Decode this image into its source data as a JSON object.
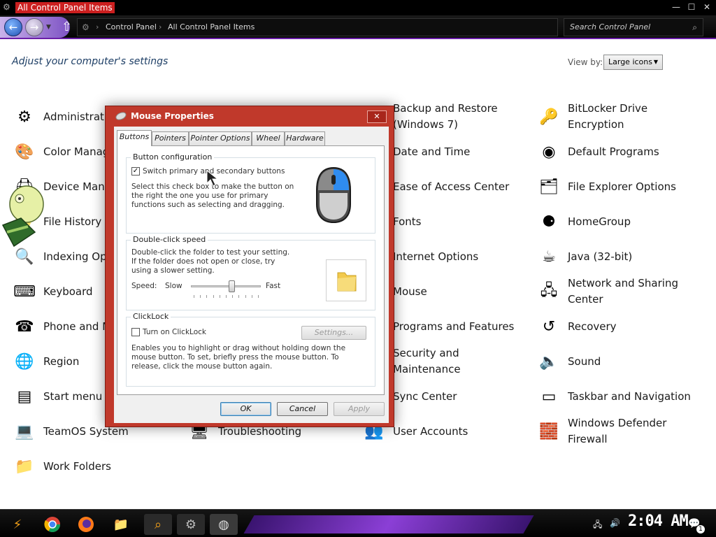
{
  "window": {
    "title": "All Control Panel Items"
  },
  "address": {
    "crumbs": [
      "Control Panel",
      "All Control Panel Items"
    ]
  },
  "search": {
    "placeholder": "Search Control Panel"
  },
  "header": {
    "title": "Adjust your computer's settings",
    "view_by_label": "View by:",
    "view_by_value": "Large icons"
  },
  "items": {
    "col1": [
      "Administrative Tools",
      "Color Management",
      "Device Manager",
      "File History",
      "Indexing Options",
      "Keyboard",
      "Phone and Modem",
      "Region",
      "Start menu",
      "TeamOS System",
      "Work Folders"
    ],
    "col2": [
      "Troubleshooting"
    ],
    "col3": [
      "Backup and Restore (Windows 7)",
      "Date and Time",
      "Ease of Access Center",
      "Fonts",
      "Internet Options",
      "Mouse",
      "Programs and Features",
      "Security and Maintenance",
      "Sync Center",
      "User Accounts"
    ],
    "col4": [
      "BitLocker Drive Encryption",
      "Default Programs",
      "File Explorer Options",
      "HomeGroup",
      "Java (32-bit)",
      "Network and Sharing Center",
      "Recovery",
      "Sound",
      "Taskbar and Navigation",
      "Windows Defender Firewall"
    ]
  },
  "dialog": {
    "title": "Mouse Properties",
    "tabs": [
      "Buttons",
      "Pointers",
      "Pointer Options",
      "Wheel",
      "Hardware"
    ],
    "button_config": {
      "title": "Button configuration",
      "checkbox_label": "Switch primary and secondary buttons",
      "checked": true,
      "description": "Select this check box to make the button on the right the one you use for primary functions such as selecting and dragging."
    },
    "double_click": {
      "title": "Double-click speed",
      "description": "Double-click the folder to test your setting. If the folder does not open or close, try using a slower setting.",
      "speed_label": "Speed:",
      "slow_label": "Slow",
      "fast_label": "Fast",
      "speed_fraction": 0.58
    },
    "clicklock": {
      "title": "ClickLock",
      "checkbox_label": "Turn on ClickLock",
      "checked": false,
      "settings_label": "Settings...",
      "description": "Enables you to highlight or drag without holding down the mouse button. To set, briefly press the mouse button. To release, click the mouse button again."
    },
    "buttons": {
      "ok": "OK",
      "cancel": "Cancel",
      "apply": "Apply"
    }
  },
  "taskbar": {
    "clock": "2:04 AM",
    "notification_count": "1"
  },
  "colors": {
    "dialog_frame": "#c0392b",
    "title_highlight": "#cc1f1f",
    "accent_purple": "#6b1fa8",
    "heading": "#1e3f66"
  }
}
